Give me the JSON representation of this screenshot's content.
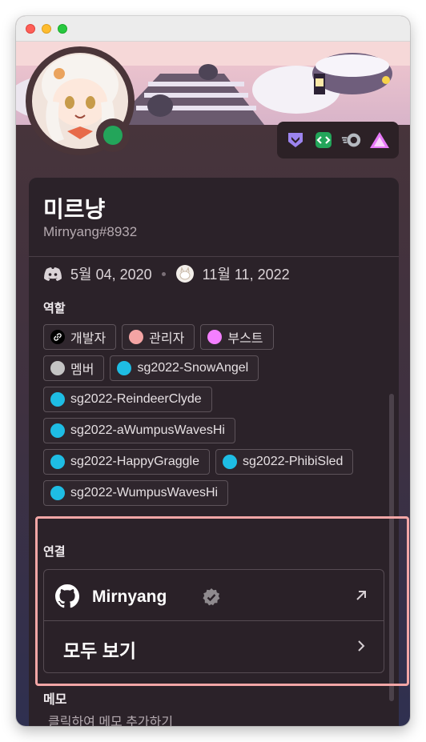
{
  "profile": {
    "display_name": "미르냥",
    "tag": "Mirnyang#8932",
    "status": "online",
    "status_color": "#23a55a"
  },
  "badges": [
    {
      "icon": "hypesquad-bravery-icon",
      "color": "#9c84ef"
    },
    {
      "icon": "active-developer-icon",
      "color": "#23a55a"
    },
    {
      "icon": "nitro-icon",
      "color": "#b5bac1"
    },
    {
      "icon": "early-supporter-icon",
      "color": "#e879f9"
    }
  ],
  "dates": {
    "discord_member_since": "5월 04, 2020",
    "server_member_since": "11월 11, 2022"
  },
  "roles_section": {
    "title": "역할",
    "roles": [
      {
        "label": "개발자",
        "color": "#000000",
        "icon": "link-icon"
      },
      {
        "label": "관리자",
        "color": "#f4a4a4"
      },
      {
        "label": "부스트",
        "color": "#f47fff"
      },
      {
        "label": "멤버",
        "color": "#c4c4c4"
      },
      {
        "label": "sg2022-SnowAngel",
        "color": "#1ebde4"
      },
      {
        "label": "sg2022-ReindeerClyde",
        "color": "#1ebde4"
      },
      {
        "label": "sg2022-aWumpusWavesHi",
        "color": "#1ebde4"
      },
      {
        "label": "sg2022-HappyGraggle",
        "color": "#1ebde4"
      },
      {
        "label": "sg2022-PhibiSled",
        "color": "#1ebde4"
      },
      {
        "label": "sg2022-WumpusWavesHi",
        "color": "#1ebde4"
      }
    ]
  },
  "connections_section": {
    "title": "연결",
    "account": {
      "service_icon": "github-icon",
      "name": "Mirnyang",
      "verified": true
    },
    "view_all_label": "모두 보기",
    "highlight_color": "#f3a6a6"
  },
  "memo_section": {
    "title": "메모",
    "placeholder": "클릭하여 메모 추가하기"
  }
}
